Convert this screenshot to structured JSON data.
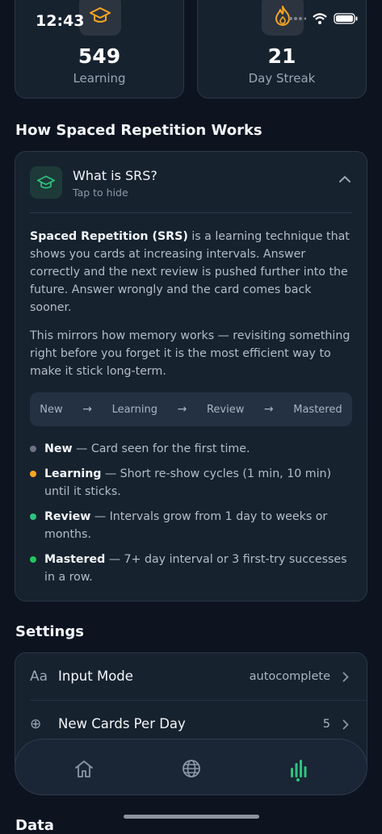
{
  "status_bar": {
    "time": "12:43"
  },
  "stats": [
    {
      "value": "549",
      "label": "Learning",
      "icon": "graduation-cap-icon",
      "icon_color": "#f5a524"
    },
    {
      "value": "21",
      "label": "Day Streak",
      "icon": "flame-icon",
      "icon_color": "#f5a524"
    }
  ],
  "srs_section": {
    "title": "How Spaced Repetition Works",
    "card": {
      "title": "What is SRS?",
      "subtitle": "Tap to hide",
      "para1_bold": "Spaced Repetition (SRS)",
      "para1_rest": " is a learning technique that shows you cards at increasing intervals. Answer correctly and the next review is pushed further into the future. Answer wrongly and the card comes back sooner.",
      "para2": "This mirrors how memory works — revisiting something right before you forget it is the most efficient way to make it stick long-term.",
      "flow": [
        "New",
        "Learning",
        "Review",
        "Mastered"
      ],
      "flow_arrow": "→",
      "legend": [
        {
          "term": "New",
          "desc": " — Card seen for the first time.",
          "color": "#6b7480"
        },
        {
          "term": "Learning",
          "desc": " — Short re-show cycles (1 min, 10 min) until it sticks.",
          "color": "#f5a524"
        },
        {
          "term": "Review",
          "desc": " — Intervals grow from 1 day to weeks or months.",
          "color": "#2ec27e"
        },
        {
          "term": "Mastered",
          "desc": " — 7+ day interval or 3 first-try successes in a row.",
          "color": "#22c55e"
        }
      ]
    }
  },
  "settings": {
    "title": "Settings",
    "rows": [
      {
        "icon": "Aa",
        "label": "Input Mode",
        "value": "autocomplete"
      },
      {
        "icon": "⊕",
        "label": "New Cards Per Day",
        "value": "5"
      }
    ]
  },
  "tabs": [
    {
      "name": "home",
      "icon": "home-icon",
      "active": false
    },
    {
      "name": "browse",
      "icon": "globe-icon",
      "active": false
    },
    {
      "name": "stats",
      "icon": "bar-chart-icon",
      "active": true
    }
  ],
  "next_section_title": "Data",
  "colors": {
    "accent": "#2ec27e",
    "warning": "#f5a524",
    "background": "#0d1420",
    "card": "#17222f"
  }
}
